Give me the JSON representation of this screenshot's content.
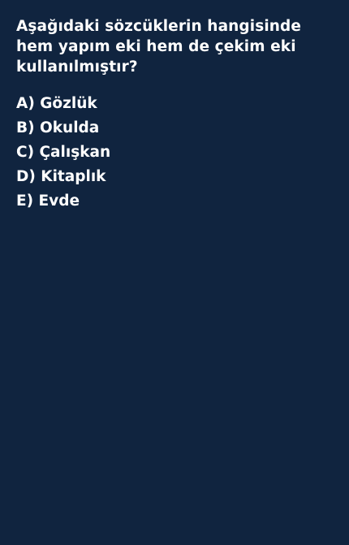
{
  "question": {
    "text": "Aşağıdaki sözcüklerin hangisinde hem yapım eki hem de çekim eki kullanılmıştır?"
  },
  "options": [
    {
      "label": "A) Gözlük"
    },
    {
      "label": "B) Okulda"
    },
    {
      "label": "C) Çalışkan"
    },
    {
      "label": "D) Kitaplık"
    },
    {
      "label": "E) Evde"
    }
  ],
  "colors": {
    "background": "#10243f",
    "text": "#ffffff"
  }
}
